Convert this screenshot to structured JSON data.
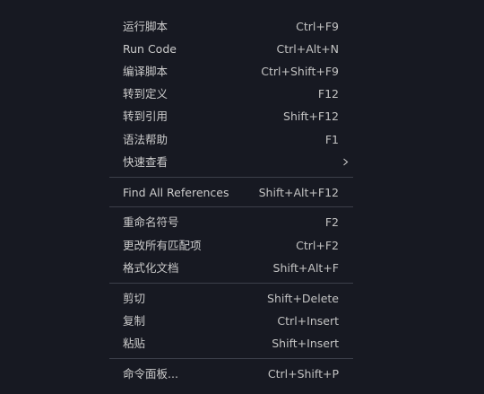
{
  "menu": {
    "groups": [
      {
        "items": [
          {
            "label": "运行脚本",
            "shortcut": "Ctrl+F9"
          },
          {
            "label": "Run Code",
            "shortcut": "Ctrl+Alt+N"
          },
          {
            "label": "编译脚本",
            "shortcut": "Ctrl+Shift+F9"
          },
          {
            "label": "转到定义",
            "shortcut": "F12"
          },
          {
            "label": "转到引用",
            "shortcut": "Shift+F12"
          },
          {
            "label": "语法帮助",
            "shortcut": "F1"
          },
          {
            "label": "快速查看",
            "shortcut": "",
            "submenu_icon": "chevron-right-icon"
          }
        ]
      },
      {
        "items": [
          {
            "label": "Find All References",
            "shortcut": "Shift+Alt+F12"
          }
        ]
      },
      {
        "items": [
          {
            "label": "重命名符号",
            "shortcut": "F2"
          },
          {
            "label": "更改所有匹配项",
            "shortcut": "Ctrl+F2"
          },
          {
            "label": "格式化文档",
            "shortcut": "Shift+Alt+F"
          }
        ]
      },
      {
        "items": [
          {
            "label": "剪切",
            "shortcut": "Shift+Delete"
          },
          {
            "label": "复制",
            "shortcut": "Ctrl+Insert"
          },
          {
            "label": "粘贴",
            "shortcut": "Shift+Insert"
          }
        ]
      },
      {
        "items": [
          {
            "label": "命令面板...",
            "shortcut": "Ctrl+Shift+P"
          }
        ]
      }
    ]
  },
  "colors": {
    "background": "#171922",
    "text": "#cccccc",
    "separator": "#3c3f4a"
  }
}
